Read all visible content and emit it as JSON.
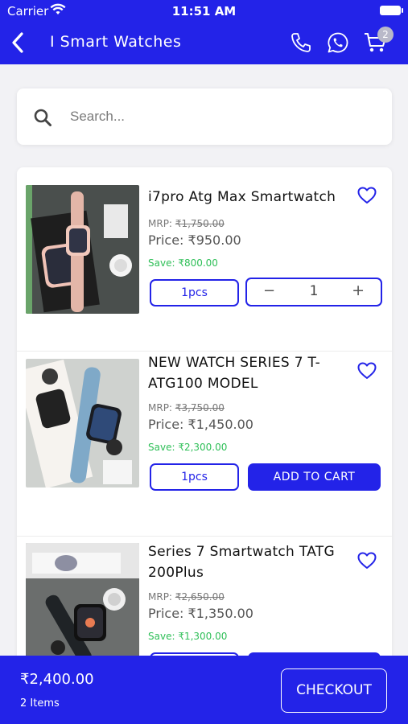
{
  "status_bar": {
    "carrier": "Carrier",
    "time": "11:51 AM"
  },
  "header": {
    "title": "I Smart Watches",
    "cart_count": "2"
  },
  "search": {
    "placeholder": "Search..."
  },
  "products": [
    {
      "name": "i7pro Atg Max Smartwatch",
      "mrp_label": "MRP:",
      "mrp": "₹1,750.00",
      "price": "Price: ₹950.00",
      "save": "Save: ₹800.00",
      "pcs": "1pcs",
      "qty": "1",
      "minus": "−",
      "plus": "+",
      "image_colors": {
        "bg": "#4a4f4d",
        "band": "#e3b6a8"
      }
    },
    {
      "name": "NEW WATCH SERIES 7 T-ATG100 MODEL",
      "mrp_label": "MRP:",
      "mrp": "₹3,750.00",
      "price": "Price: ₹1,450.00",
      "save": "Save: ₹2,300.00",
      "pcs": "1pcs",
      "add_to_cart": "ADD TO CART",
      "image_colors": {
        "bg": "#d6d7d4",
        "band": "#7fa9c8"
      }
    },
    {
      "name": "Series 7 Smartwatch TATG 200Plus",
      "mrp_label": "MRP:",
      "mrp": "₹2,650.00",
      "price": "Price: ₹1,350.00",
      "save": "Save: ₹1,300.00",
      "image_colors": {
        "bg": "#6b6e6d",
        "band": "#1f2326"
      }
    }
  ],
  "footer": {
    "total": "₹2,400.00",
    "items": "2 Items",
    "checkout": "CHECKOUT"
  },
  "colors": {
    "primary": "#2323e8",
    "save_green": "#2fbf58"
  }
}
